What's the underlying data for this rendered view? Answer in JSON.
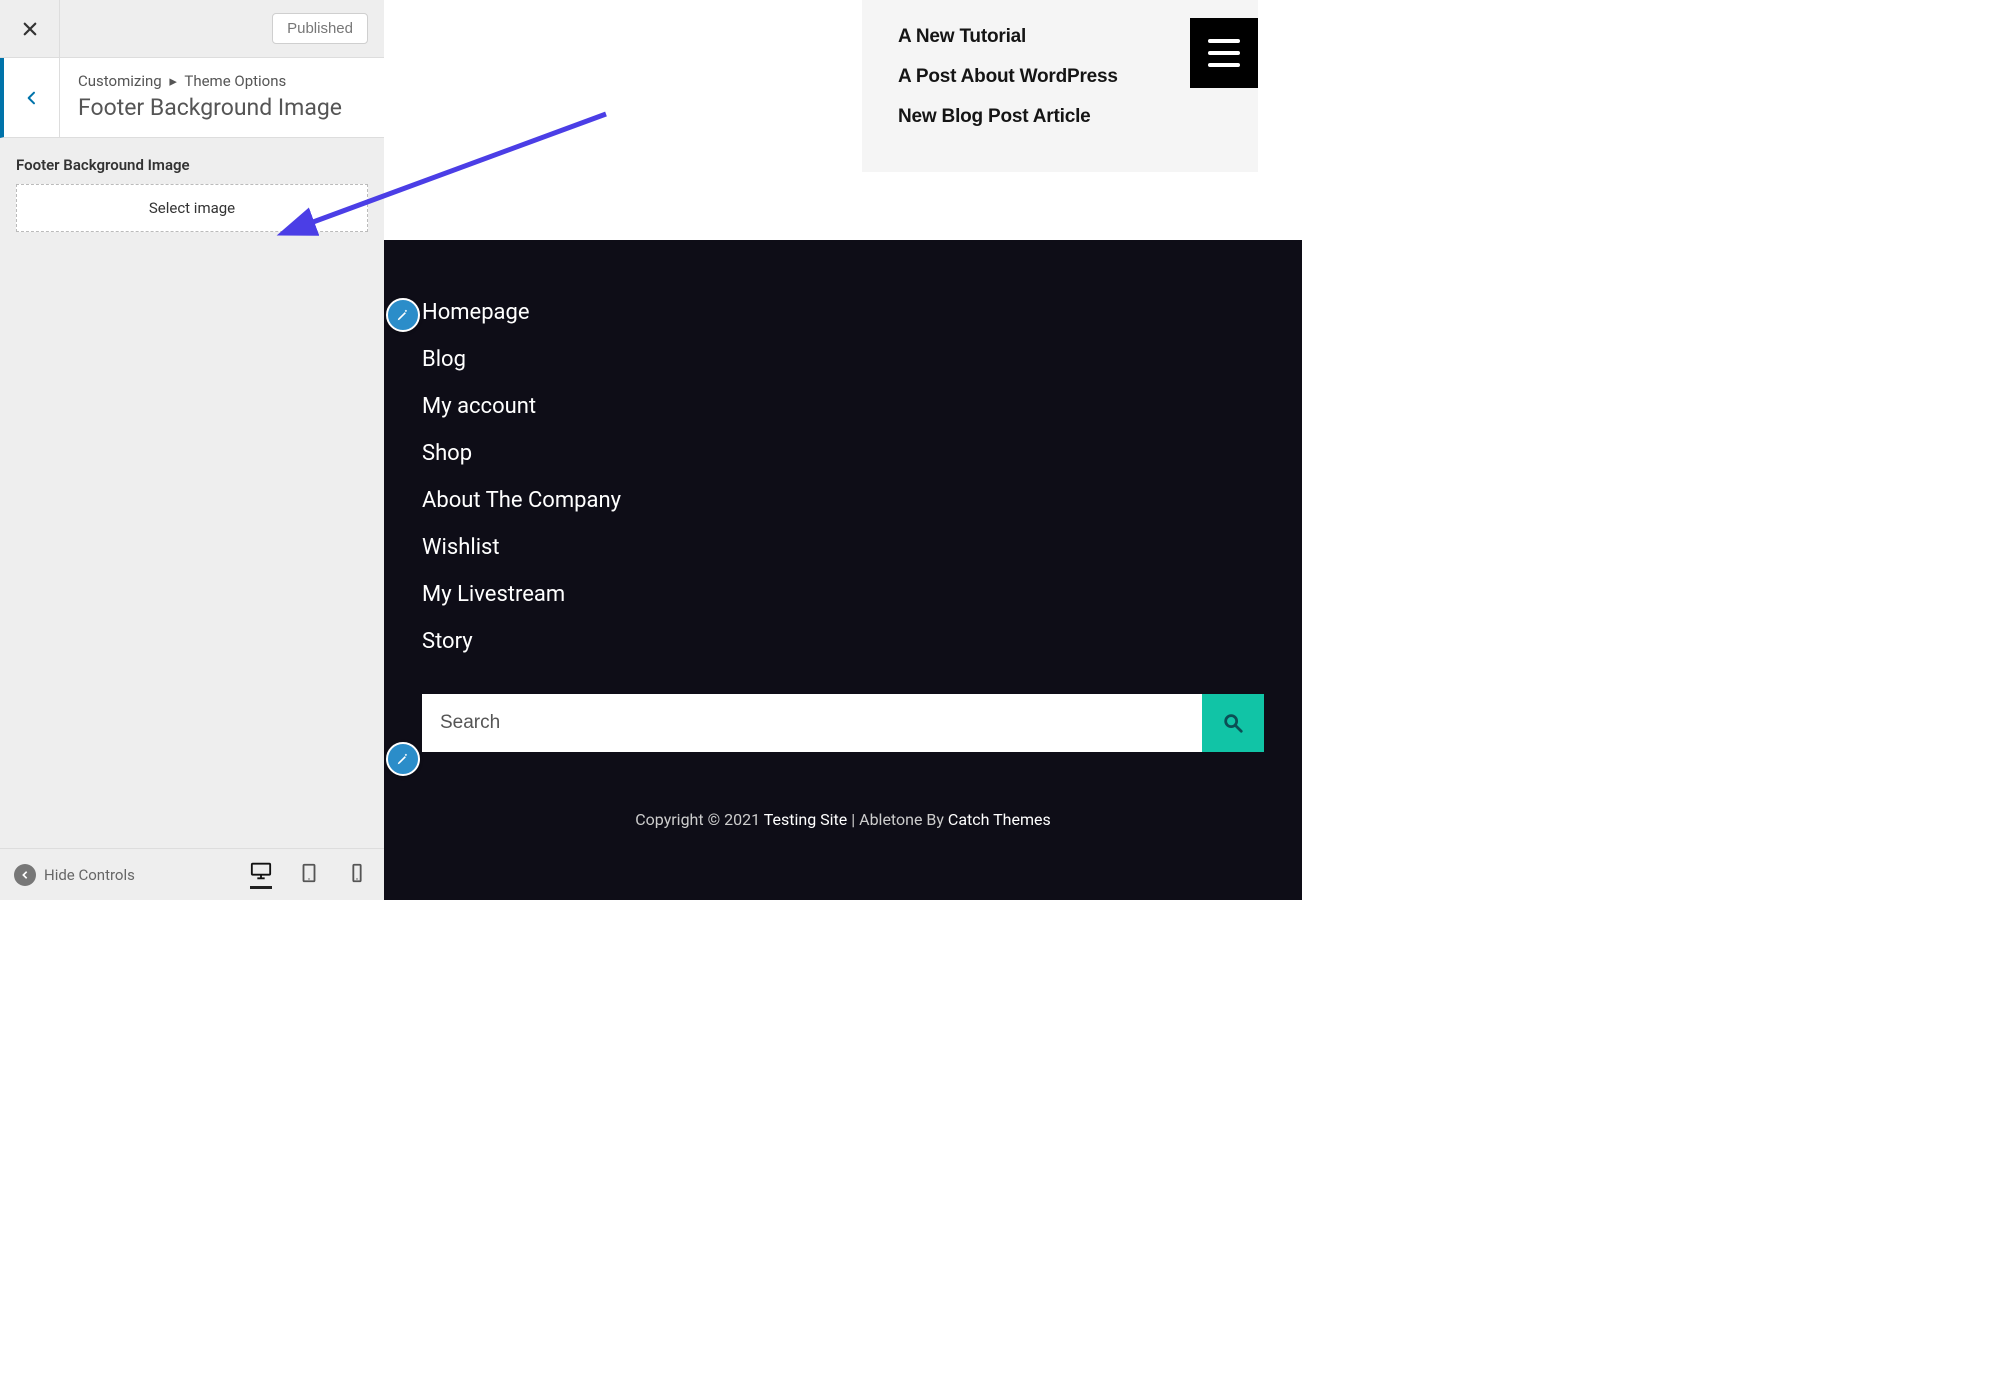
{
  "sidebar": {
    "publish_label": "Published",
    "breadcrumb_root": "Customizing",
    "breadcrumb_parent": "Theme Options",
    "section_title": "Footer Background Image",
    "control_label": "Footer Background Image",
    "select_image_label": "Select image",
    "hide_controls_label": "Hide Controls"
  },
  "preview": {
    "recent_posts": [
      "A New Tutorial",
      "A Post About WordPress",
      "New Blog Post Article"
    ],
    "footer_nav": [
      "Homepage",
      "Blog",
      "My account",
      "Shop",
      "About The Company",
      "Wishlist",
      "My Livestream",
      "Story"
    ],
    "search_placeholder": "Search",
    "copyright": {
      "prefix": "Copyright © 2021 ",
      "site": "Testing Site",
      "middle": " | Abletone By ",
      "theme": "Catch Themes"
    }
  },
  "colors": {
    "accent": "#11c4a6",
    "arrow": "#4b3ee6",
    "edit_shortcut": "#2b8dc9",
    "footer_bg": "#0e0d17"
  }
}
